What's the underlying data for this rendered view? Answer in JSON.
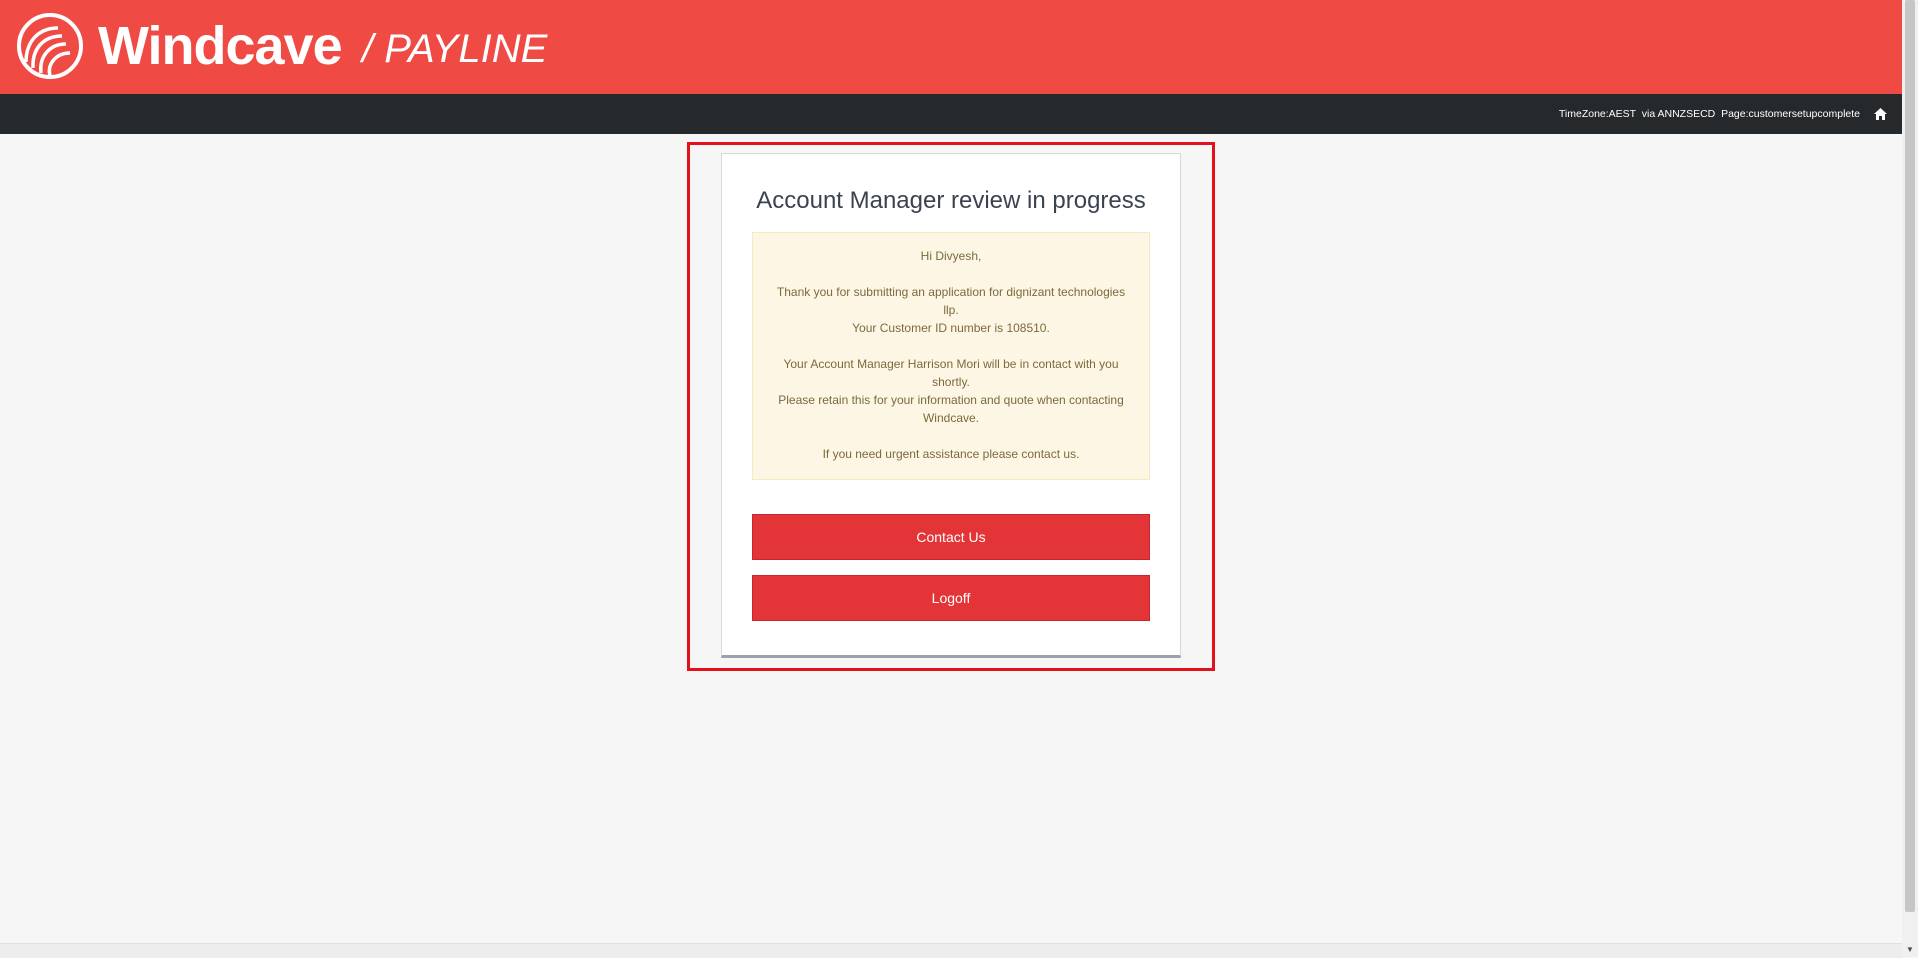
{
  "header": {
    "brand": "Windcave",
    "product": "/ PAYLINE",
    "background": "#ef4b44"
  },
  "navbar": {
    "info": "TimeZone:AEST  via ANNZSECD  Page:customersetupcomplete",
    "home_icon": "home-icon"
  },
  "card": {
    "title": "Account Manager review in progress",
    "notice": {
      "greeting": "Hi Divyesh,",
      "line1": "Thank you for submitting an application for dignizant technologies llp.",
      "line2": "Your Customer ID number is 108510.",
      "line3": "Your Account Manager Harrison Mori will be in contact with you shortly.",
      "line4": "Please retain this for your information and quote when contacting Windcave.",
      "line5": "If you need urgent assistance please contact us."
    },
    "contact_button": "Contact Us",
    "logoff_button": "Logoff"
  },
  "colors": {
    "accent": "#ef4b44",
    "button": "#e33437",
    "navbar": "#26292c",
    "notice_bg": "#fdf6e4",
    "highlight_border": "#e3111b"
  }
}
